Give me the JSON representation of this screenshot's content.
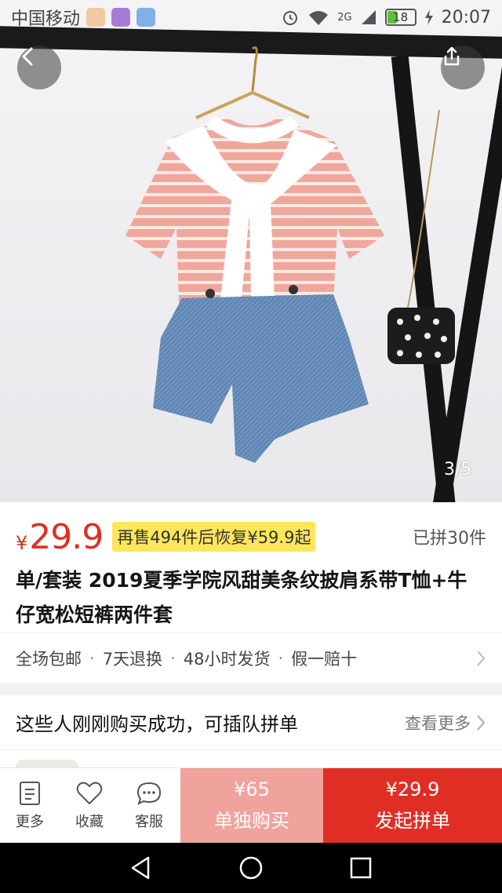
{
  "status_bar": {
    "carrier": "中国移动",
    "network": "2G",
    "battery": "18",
    "time": "20:07"
  },
  "gallery": {
    "pager": "3/5"
  },
  "product": {
    "price_symbol": "¥",
    "price": "29.9",
    "restore_note": "再售494件后恢复¥59.9起",
    "joined_count": "已拼30件",
    "title": "单/套装 2019夏季学院风甜美条纹披肩系带T恤+牛仔宽松短裤两件套"
  },
  "services": {
    "items": [
      "全场包邮",
      "7天退换",
      "48小时发货",
      "假一赔十"
    ],
    "separator": "·"
  },
  "group_buy": {
    "text": "这些人刚刚购买成功，可插队拼单",
    "more": "查看更多"
  },
  "bottom_bar": {
    "more_label": "更多",
    "favorite_label": "收藏",
    "service_label": "客服",
    "solo_price": "¥65",
    "solo_label": "单独购买",
    "group_price": "¥29.9",
    "group_label": "发起拼单"
  },
  "colors": {
    "accent": "#e02e24",
    "solo_button": "#f0a29d",
    "tag_bg": "#fde65a"
  }
}
